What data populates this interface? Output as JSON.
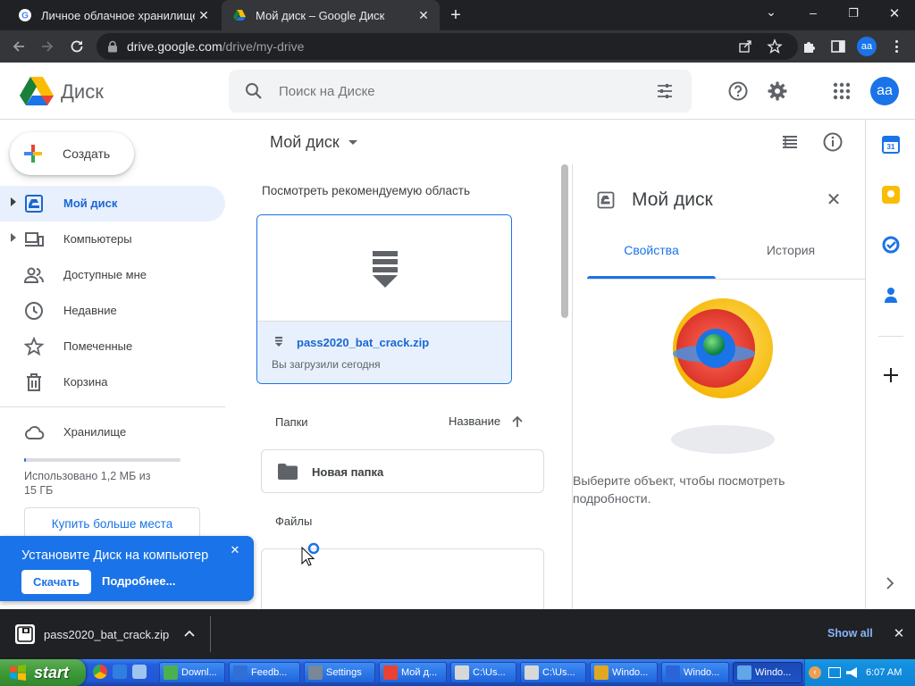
{
  "browser": {
    "tabs": [
      {
        "title": "Личное облачное хранилище и",
        "close": "✕"
      },
      {
        "title": "Мой диск – Google Диск",
        "close": "✕"
      }
    ],
    "new_tab": "+",
    "url_host": "drive.google.com",
    "url_path": "/drive/my-drive",
    "profile_initials": "aa",
    "window_controls": {
      "chevron": "⌄",
      "minimize": "–",
      "restore": "❐",
      "close": "✕"
    }
  },
  "drive": {
    "logo_text": "Диск",
    "search_placeholder": "Поиск на Диске",
    "avatar_initials": "aa",
    "brand_colors": {
      "blue": "#1a73e8",
      "green": "#188038",
      "yellow": "#fbbc04",
      "red": "#ea4335"
    }
  },
  "sidebar": {
    "create_label": "Создать",
    "items": [
      {
        "label": "Мой диск",
        "active": true
      },
      {
        "label": "Компьютеры"
      },
      {
        "label": "Доступные мне"
      },
      {
        "label": "Недавние"
      },
      {
        "label": "Помеченные"
      },
      {
        "label": "Корзина"
      }
    ],
    "storage_label": "Хранилище",
    "storage_used_line1": "Использовано 1,2 МБ из",
    "storage_used_line2": "15 ГБ",
    "storage_fraction": 0.0001,
    "buy_button": "Купить больше места"
  },
  "install_banner": {
    "title": "Установите Диск на компьютер",
    "download_button": "Скачать",
    "more_link": "Подробнее...",
    "close": "✕"
  },
  "main": {
    "title": "Мой диск",
    "suggested_heading": "Посмотреть рекомендуемую область",
    "suggested_file": {
      "name": "pass2020_bat_crack.zip",
      "subtitle": "Вы загрузили сегодня"
    },
    "folders_heading": "Папки",
    "sort_label": "Название",
    "folders": [
      {
        "name": "Новая папка"
      }
    ],
    "files_heading": "Файлы"
  },
  "details": {
    "title": "Мой диск",
    "tabs": [
      {
        "label": "Свойства",
        "active": true
      },
      {
        "label": "История"
      }
    ],
    "empty_text_line1": "Выберите объект, чтобы посмотреть",
    "empty_text_line2": "подробности."
  },
  "rail": {
    "calendar_day": "31"
  },
  "download_shelf": {
    "file_name": "pass2020_bat_crack.zip",
    "show_all": "Show all",
    "close": "✕"
  },
  "taskbar": {
    "start": "start",
    "tasks": [
      {
        "label": "Downl...",
        "icon_color": "#4caf50"
      },
      {
        "label": "Feedb...",
        "icon_color": "#2f6fd6"
      },
      {
        "label": "Settings",
        "icon_color": "#7a8796"
      },
      {
        "label": "Мой д...",
        "icon_color": "#e94235"
      },
      {
        "label": "C:\\Us...",
        "icon_color": "#d8d8d8"
      },
      {
        "label": "C:\\Us...",
        "icon_color": "#d8d8d8"
      },
      {
        "label": "Windo...",
        "icon_color": "#e0a820"
      },
      {
        "label": "Windo...",
        "icon_color": "#2a64d8"
      },
      {
        "label": "Windo...",
        "icon_color": "#5fa7e8",
        "active": true
      }
    ],
    "clock": "6:07 AM"
  }
}
